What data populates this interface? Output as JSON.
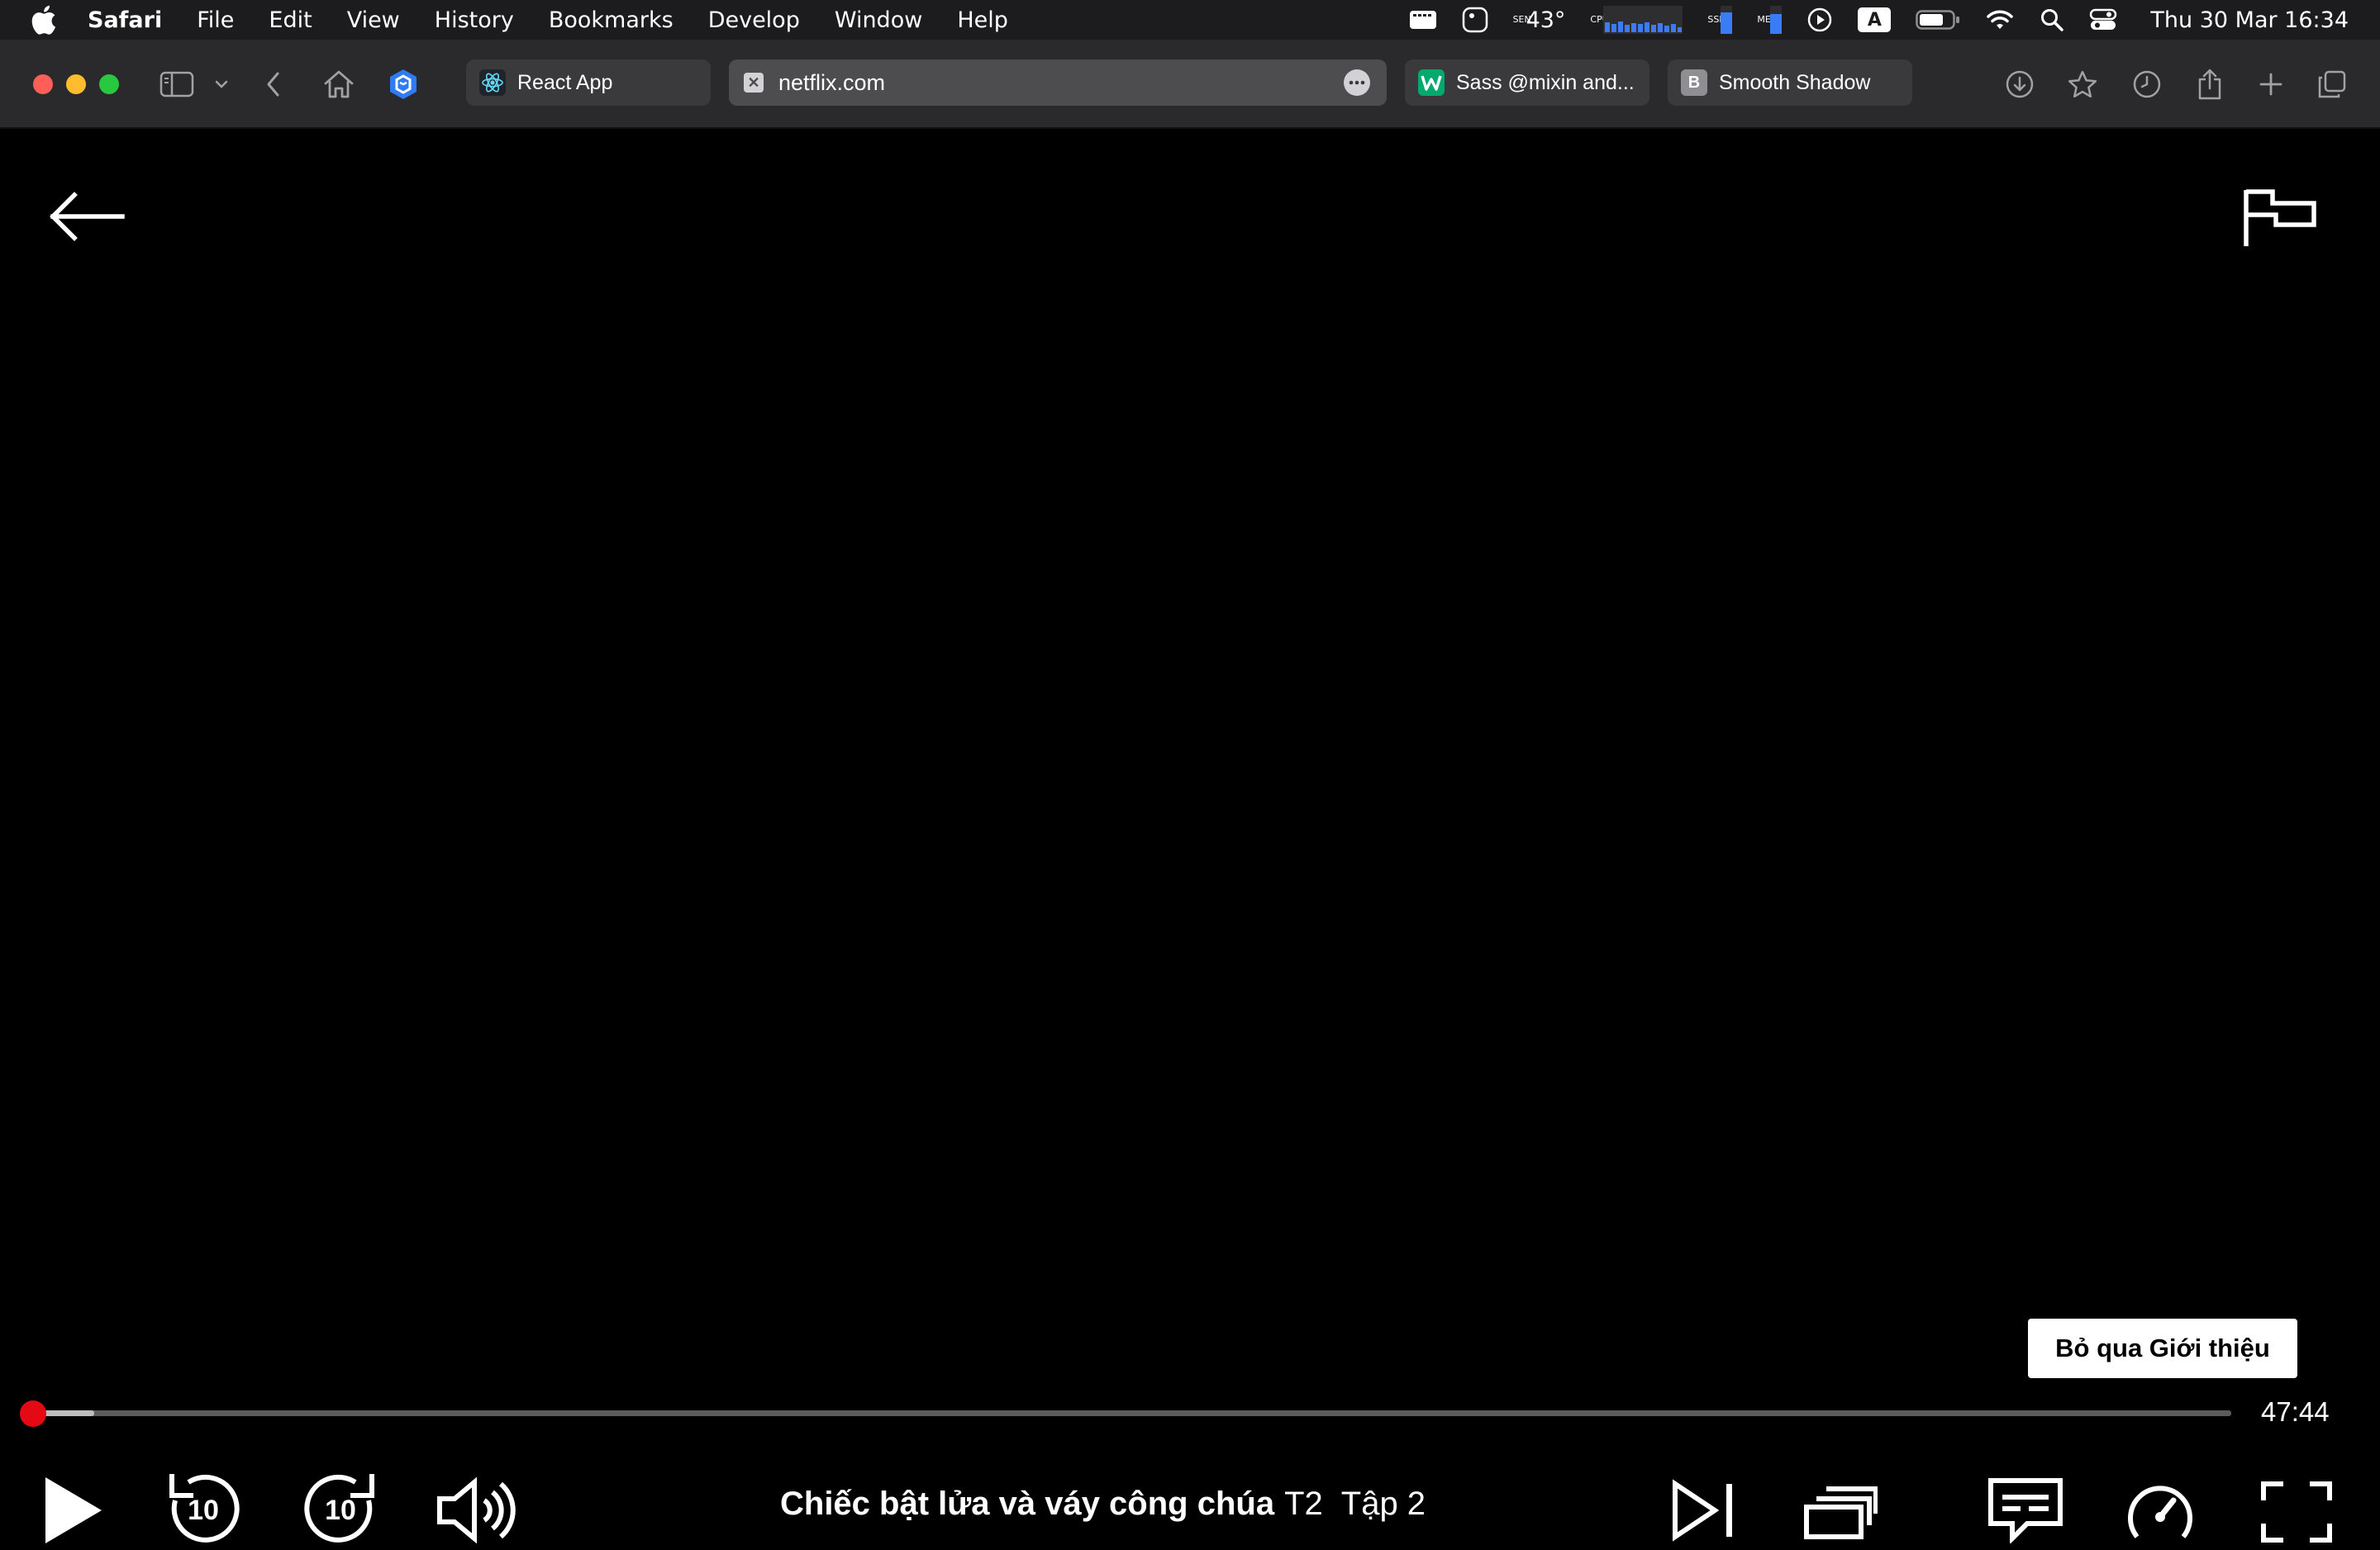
{
  "menubar": {
    "app_name": "Safari",
    "items": [
      "File",
      "Edit",
      "View",
      "History",
      "Bookmarks",
      "Develop",
      "Window",
      "Help"
    ],
    "status": {
      "temperature": "43°",
      "sensor_label": "SEN",
      "cpu_label": "CPU",
      "ssd_label": "SSD",
      "mem_label": "MEM",
      "input_source": "A",
      "clock": "Thu 30 Mar  16:34"
    }
  },
  "browser": {
    "tabs": [
      {
        "title": "React App",
        "favicon": "react-icon",
        "active": false
      },
      {
        "title": "netflix.com",
        "favicon": "netflix-icon",
        "active": true
      },
      {
        "title": "Sass @mixin and...",
        "favicon": "w-icon",
        "active": false
      },
      {
        "title": "Smooth Shadow",
        "favicon": "b-icon",
        "favicon_letter": "B",
        "active": false
      }
    ]
  },
  "player": {
    "skip_intro_label": "Bỏ qua Giới thiệu",
    "time_remaining": "47:44",
    "progress_played_fraction": 0.0,
    "progress_buffered_fraction": 0.028,
    "show_title": "Chiếc bật lửa và váy công chúa",
    "season": "T2",
    "episode": "Tập 2",
    "rewind_seconds": "10",
    "forward_seconds": "10",
    "accent_color": "#e50914"
  }
}
